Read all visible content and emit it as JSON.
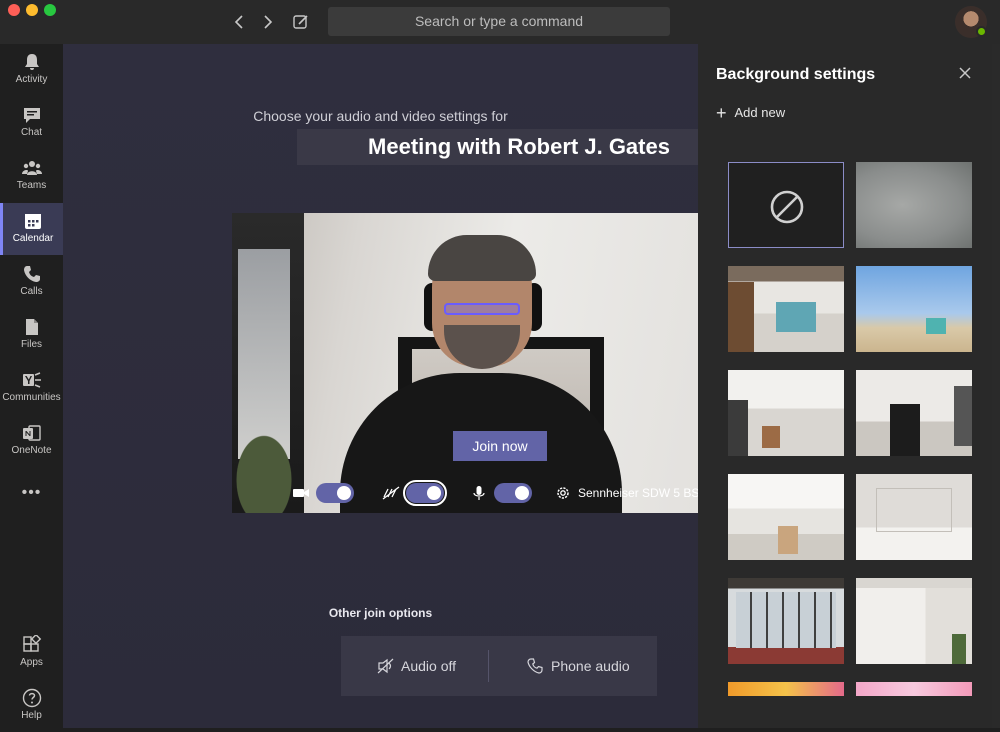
{
  "titlebar": {
    "search_placeholder": "Search or type a command",
    "back_icon": "chevron-left-icon",
    "forward_icon": "chevron-right-icon",
    "compose_icon": "compose-icon"
  },
  "rail": {
    "items": [
      {
        "label": "Activity",
        "icon": "bell-icon",
        "active": false
      },
      {
        "label": "Chat",
        "icon": "chat-icon",
        "active": false
      },
      {
        "label": "Teams",
        "icon": "teams-icon",
        "active": false
      },
      {
        "label": "Calendar",
        "icon": "calendar-icon",
        "active": true
      },
      {
        "label": "Calls",
        "icon": "phone-icon",
        "active": false
      },
      {
        "label": "Files",
        "icon": "file-icon",
        "active": false
      },
      {
        "label": "Communities",
        "icon": "yammer-icon",
        "active": false
      },
      {
        "label": "OneNote",
        "icon": "onenote-icon",
        "active": false
      }
    ],
    "more": "•••",
    "bottom_items": [
      {
        "label": "Apps",
        "icon": "apps-icon"
      },
      {
        "label": "Help",
        "icon": "help-icon"
      }
    ]
  },
  "prejoin": {
    "subtitle": "Choose your audio and video settings for",
    "meeting_title": "Meeting with Robert J. Gates",
    "join_label": "Join now",
    "device_label": "Sennheiser SDW 5 BS - U",
    "video_on": true,
    "background_blur_on": true,
    "mic_on": true,
    "other_options_label": "Other join options",
    "audio_off_label": "Audio off",
    "phone_audio_label": "Phone audio"
  },
  "background_panel": {
    "title": "Background settings",
    "add_new_label": "Add new",
    "tiles": [
      {
        "kind": "none",
        "selected": true
      },
      {
        "kind": "blur"
      },
      {
        "kind": "office"
      },
      {
        "kind": "beach"
      },
      {
        "kind": "white-room-1"
      },
      {
        "kind": "white-room-2"
      },
      {
        "kind": "white-room-3"
      },
      {
        "kind": "white-room-4"
      },
      {
        "kind": "loft-1"
      },
      {
        "kind": "loft-2"
      },
      {
        "kind": "balloons-1"
      },
      {
        "kind": "balloons-2"
      }
    ]
  },
  "colors": {
    "accent": "#6264a7",
    "rail_active": "#3a3b55",
    "panel_bg": "#292929"
  }
}
